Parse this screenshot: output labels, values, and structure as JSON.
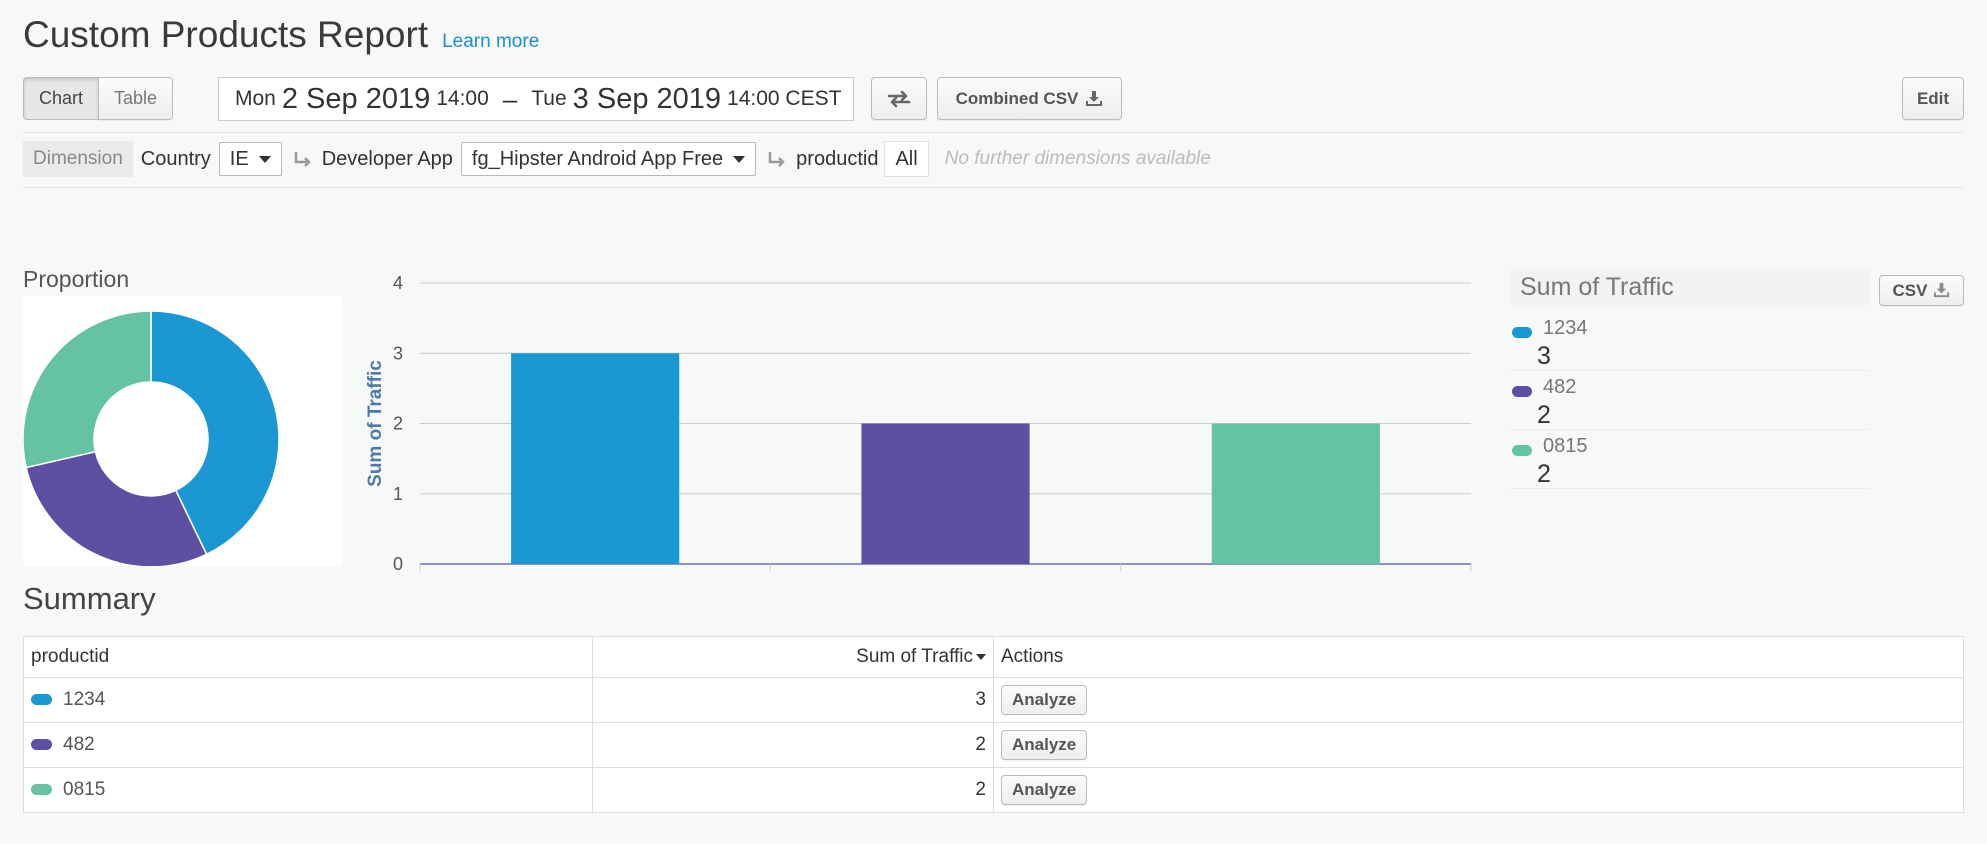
{
  "header": {
    "title": "Custom Products Report",
    "learn_more": "Learn more"
  },
  "toolbar": {
    "view_chart": "Chart",
    "view_table": "Table",
    "date_from_day": "Mon",
    "date_from_date": "2 Sep 2019",
    "date_from_time": "14:00",
    "date_separator": "–",
    "date_to_day": "Tue",
    "date_to_date": "3 Sep 2019",
    "date_to_time": "14:00 CEST",
    "combined_csv": "Combined CSV",
    "edit": "Edit"
  },
  "dimensions": {
    "label": "Dimension",
    "country_label": "Country",
    "country_value": "IE",
    "developer_app_label": "Developer App",
    "developer_app_value": "fg_Hipster Android App Free",
    "productid_label": "productid",
    "productid_value": "All",
    "no_further": "No further dimensions available"
  },
  "proportion": {
    "title": "Proportion"
  },
  "colors": {
    "c1234": "#1b97d3",
    "c482": "#5e4fa2",
    "c0815": "#66c2a5"
  },
  "chart_data": [
    {
      "type": "pie",
      "title": "Proportion",
      "donut": true,
      "categories": [
        "1234",
        "482",
        "0815"
      ],
      "values": [
        3,
        2,
        2
      ],
      "colors": [
        "#1b97d3",
        "#5e4fa2",
        "#66c2a5"
      ]
    },
    {
      "type": "bar",
      "ylabel": "Sum of Traffic",
      "categories": [
        "1234",
        "482",
        "0815"
      ],
      "values": [
        3,
        2,
        2
      ],
      "colors": [
        "#1b97d3",
        "#5e4fa2",
        "#66c2a5"
      ],
      "ylim": [
        0,
        4
      ],
      "yticks": [
        "0",
        "1",
        "2",
        "3",
        "4"
      ],
      "grid": true
    }
  ],
  "legend": {
    "title": "Sum of Traffic",
    "csv": "CSV",
    "items": [
      {
        "name": "1234",
        "value": "3"
      },
      {
        "name": "482",
        "value": "2"
      },
      {
        "name": "0815",
        "value": "2"
      }
    ]
  },
  "summary": {
    "title": "Summary",
    "columns": [
      "productid",
      "Sum of Traffic",
      "Actions"
    ],
    "rows": [
      {
        "name": "1234",
        "value": "3",
        "action": "Analyze"
      },
      {
        "name": "482",
        "value": "2",
        "action": "Analyze"
      },
      {
        "name": "0815",
        "value": "2",
        "action": "Analyze"
      }
    ]
  }
}
